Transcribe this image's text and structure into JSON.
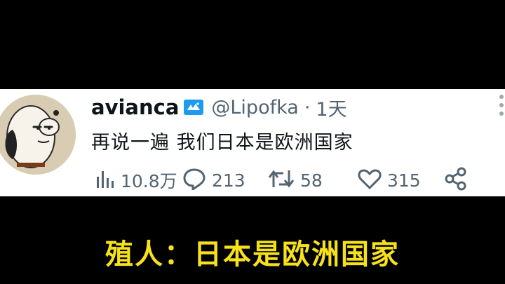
{
  "post": {
    "display_name": "avianca",
    "handle": "@Lipofka",
    "separator": "·",
    "time": "1天",
    "text": "再说一遍 我们日本是欧洲国家",
    "stats": {
      "views": "10.8万",
      "replies": "213",
      "reposts": "58",
      "likes": "315"
    }
  },
  "caption": "殖人：日本是欧洲国家",
  "icons": [
    "verified-icon",
    "more-icon",
    "views-icon",
    "reply-icon",
    "repost-icon",
    "like-icon",
    "share-icon"
  ],
  "colors": {
    "caption": "#f7e21a",
    "muted": "#536471",
    "verified": "#1d9bf0"
  }
}
